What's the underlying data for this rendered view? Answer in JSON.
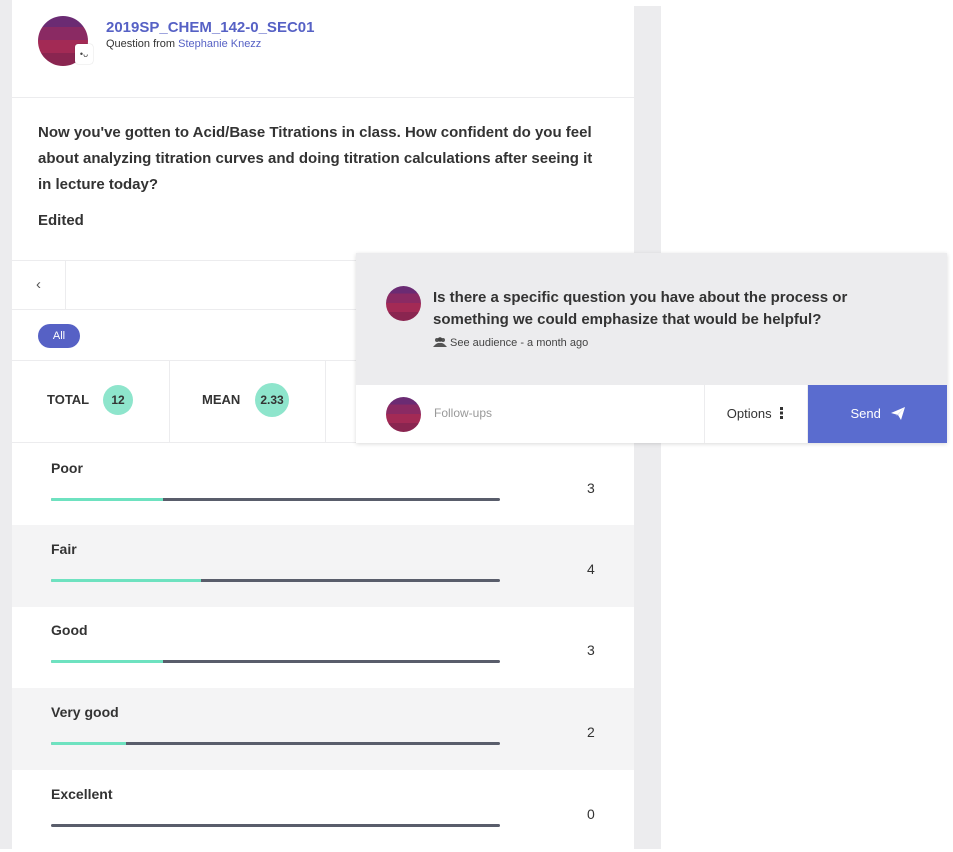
{
  "header": {
    "course": "2019SP_CHEM_142-0_SEC01",
    "from_prefix": "Question from ",
    "from_name": "Stephanie Knezz"
  },
  "question": {
    "text": "Now you've gotten to Acid/Base Titrations in class. How confident do you feel about analyzing titration curves and doing titration calculations after seeing it in lecture today?",
    "edited": "Edited"
  },
  "nav": {
    "back_icon": "chevron-left-icon",
    "back_glyph": "‹"
  },
  "filter": {
    "all_label": "All"
  },
  "stats": {
    "total_label": "TOTAL",
    "total_value": "12",
    "mean_label": "MEAN",
    "mean_value": "2.33"
  },
  "options": [
    {
      "label": "Poor",
      "count": "3",
      "fraction": 0.25
    },
    {
      "label": "Fair",
      "count": "4",
      "fraction": 0.333
    },
    {
      "label": "Good",
      "count": "3",
      "fraction": 0.25
    },
    {
      "label": "Very good",
      "count": "2",
      "fraction": 0.167
    },
    {
      "label": "Excellent",
      "count": "0",
      "fraction": 0
    }
  ],
  "popup": {
    "text": "Is there a specific question you have about the process or something we could emphasize that would be helpful?",
    "audience_icon": "users-icon",
    "meta": "See audience - a month ago",
    "followups_placeholder": "Follow-ups",
    "options_label": "Options",
    "options_icon": "vertical-dots-icon",
    "send_label": "Send",
    "send_icon": "paper-plane-icon"
  },
  "colors": {
    "accent": "#5661c5",
    "send_button": "#5a6ccf",
    "bar_fill": "#6ee2c0",
    "bar_track": "#595d6b",
    "stat_circle": "#8ee5cc"
  }
}
